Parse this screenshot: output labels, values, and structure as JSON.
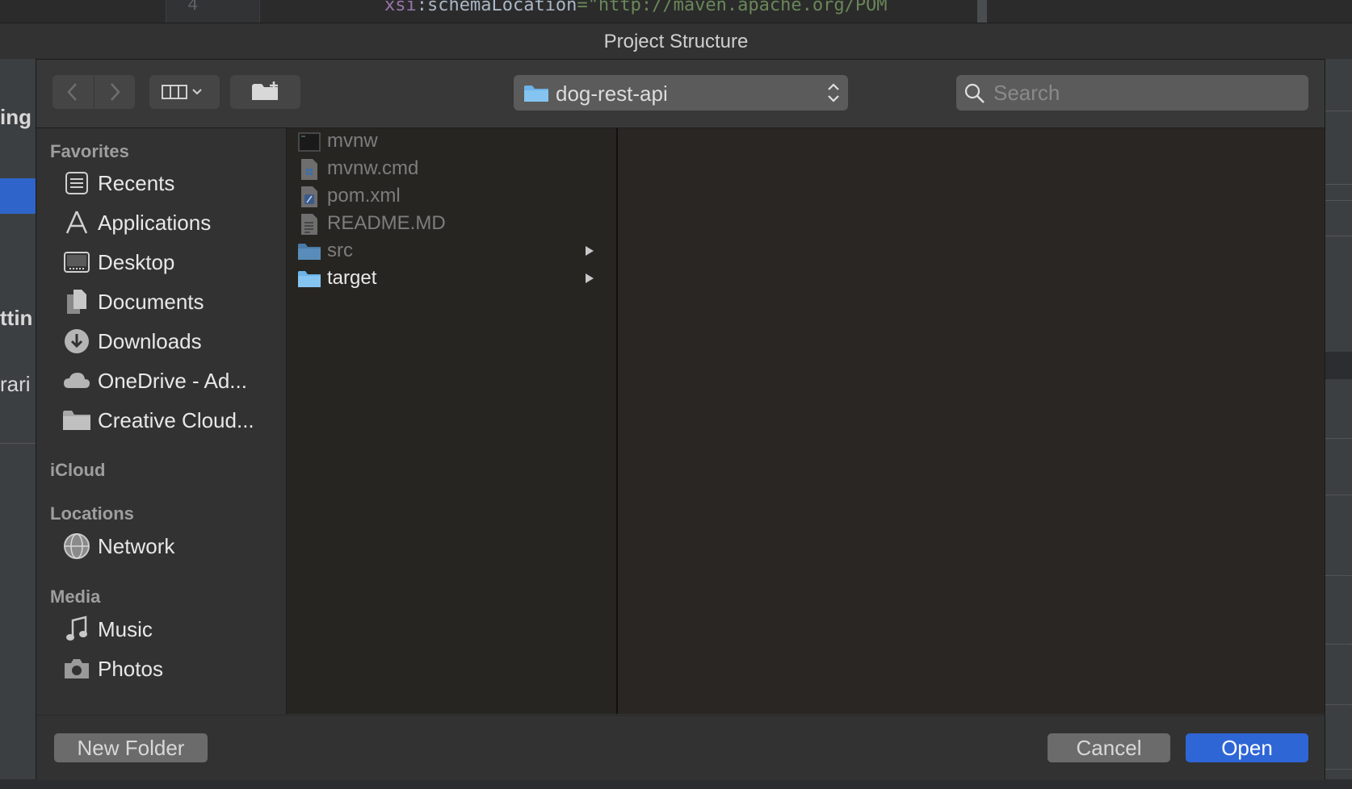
{
  "ide": {
    "line_number": "4",
    "code_attr": "xsi",
    "code_sep": ":schemaLocation",
    "code_eq": "=",
    "code_str": "\"http://maven.apache.org/POM"
  },
  "left_fragments": [
    "ing",
    "ttin",
    "rari"
  ],
  "window": {
    "title": "Project Structure"
  },
  "toolbar": {
    "back_icon": "chevron-left-icon",
    "forward_icon": "chevron-right-icon",
    "view_icon": "column-view-icon",
    "new_folder_icon": "folder-plus-icon",
    "path": "dog-rest-api",
    "search_placeholder": "Search"
  },
  "sidebar": {
    "favorites_heading": "Favorites",
    "favorites": [
      {
        "label": "Recents",
        "icon": "recents-icon"
      },
      {
        "label": "Applications",
        "icon": "applications-icon"
      },
      {
        "label": "Desktop",
        "icon": "desktop-icon"
      },
      {
        "label": "Documents",
        "icon": "documents-icon"
      },
      {
        "label": "Downloads",
        "icon": "downloads-icon"
      },
      {
        "label": "OneDrive - Ad...",
        "icon": "cloud-icon"
      },
      {
        "label": "Creative Cloud...",
        "icon": "folder-icon"
      }
    ],
    "icloud_heading": "iCloud",
    "locations_heading": "Locations",
    "locations": [
      {
        "label": "Network",
        "icon": "network-globe-icon"
      }
    ],
    "media_heading": "Media",
    "media": [
      {
        "label": "Music",
        "icon": "music-note-icon"
      },
      {
        "label": "Photos",
        "icon": "camera-icon"
      }
    ]
  },
  "files": [
    {
      "name": "mvnw",
      "type": "executable",
      "enabled": false,
      "has_children": false
    },
    {
      "name": "mvnw.cmd",
      "type": "windows-file",
      "enabled": false,
      "has_children": false
    },
    {
      "name": "pom.xml",
      "type": "xml-file",
      "enabled": false,
      "has_children": false
    },
    {
      "name": "README.MD",
      "type": "text-file",
      "enabled": false,
      "has_children": false
    },
    {
      "name": "src",
      "type": "folder",
      "enabled": false,
      "has_children": true
    },
    {
      "name": "target",
      "type": "folder",
      "enabled": true,
      "has_children": true
    }
  ],
  "footer": {
    "new_folder": "New Folder",
    "cancel": "Cancel",
    "open": "Open"
  },
  "colors": {
    "accent": "#2f66d6",
    "folder": "#6db3e8"
  }
}
